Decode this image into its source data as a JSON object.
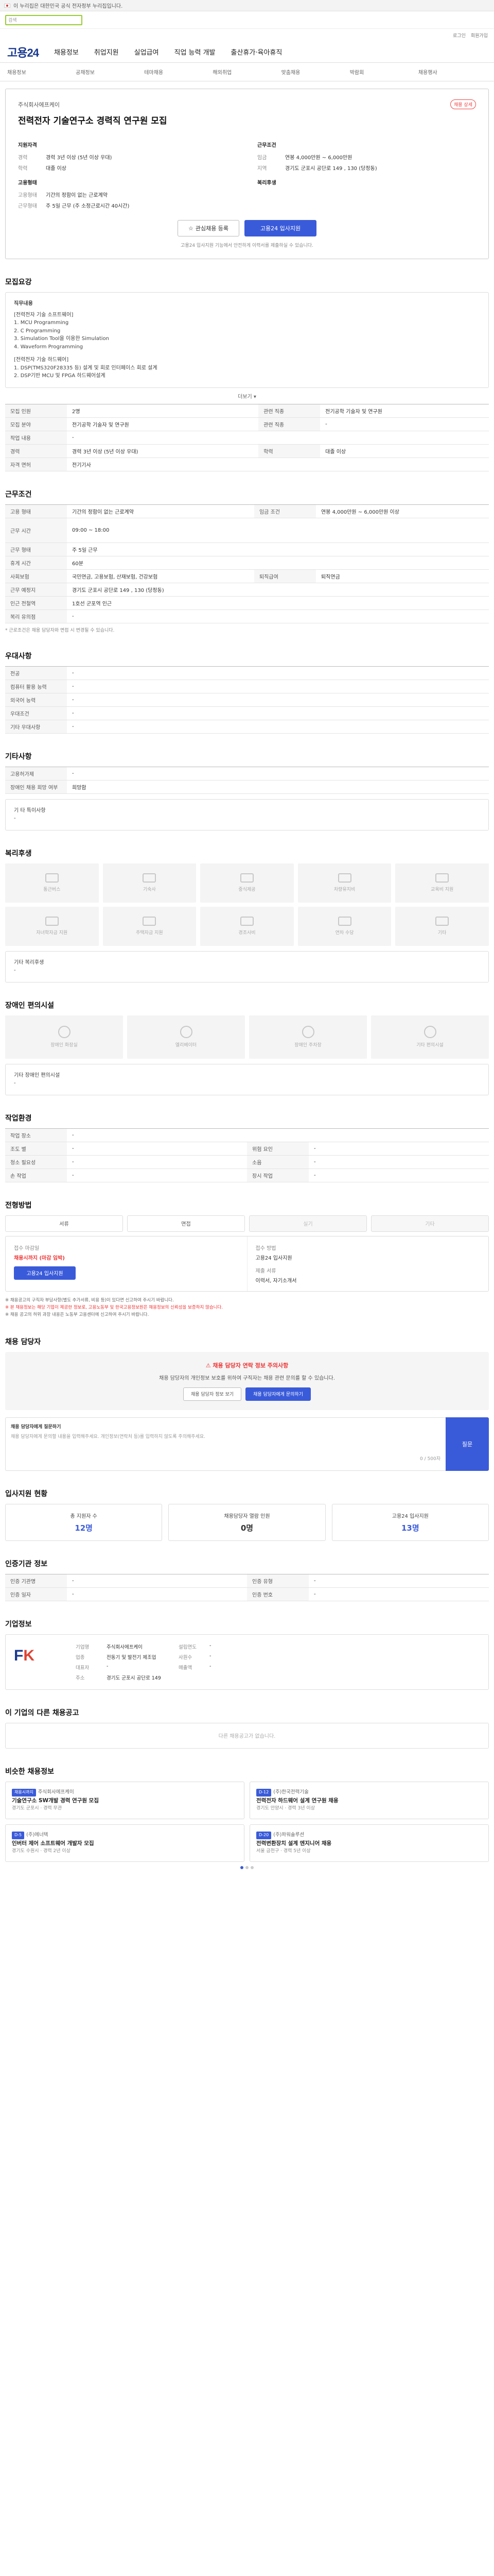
{
  "gov_bar": {
    "text": "이 누리집은 대한민국 공식 전자정부 누리집입니다."
  },
  "search": {
    "placeholder": "검색"
  },
  "top_links": [
    "로그인",
    "회원가입"
  ],
  "gnb": {
    "logo": "고용24",
    "items": [
      "채용정보",
      "취업지원",
      "실업급여",
      "직업 능력 개발",
      "출산휴가·육아휴직"
    ]
  },
  "subnav": [
    "채용정보",
    "공채정보",
    "테마채용",
    "해외취업",
    "맞춤채용",
    "박람회",
    "채용행사"
  ],
  "header": {
    "company": "주식회사에프케이",
    "share": "채용 상세",
    "title": "전력전자 기술연구소 경력직 연구원 모집",
    "left_title": "지원자격",
    "left": [
      {
        "k": "경력",
        "v": "경력 3년 이상 (5년 이상 우대)"
      },
      {
        "k": "학력",
        "v": "대졸 이상"
      }
    ],
    "left2_title": "고용형태",
    "left2": [
      {
        "k": "고용형태",
        "v": "기간의 정함이 없는 근로계약"
      },
      {
        "k": "근무형태",
        "v": "주 5일 근무 (주 소정근로시간 40시간)"
      }
    ],
    "right_title": "근무조건",
    "right": [
      {
        "k": "임금",
        "v": "연봉 4,000만원 ~ 6,000만원"
      },
      {
        "k": "지역",
        "v": "경기도 군포시 공단로 149 , 130 (당정동)"
      }
    ],
    "right2_title": "복리후생",
    "btn_save": "관심채용 등록",
    "btn_apply": "고용24 입사지원",
    "note": "고용24 입사지원 기능에서 안전하게 이력서를 제출하실 수 있습니다."
  },
  "duty": {
    "title": "모집요강",
    "body_title": "직무내용",
    "lines": [
      "[전력전자 기술 소프트웨어]",
      "1. MCU Programming",
      "2. C Programming",
      "3. Simulation Tool을 이용한 Simulation",
      "4. Waveform Programming",
      "",
      "[전력전자 기술 하드웨어]",
      "1. DSP(TMS320F28335 등) 설계 및 회로 인터페이스 회로 설계",
      "2. DSP기반 MCU 및 FPGA 하드웨어설계"
    ],
    "more": "더보기 ▾",
    "table": [
      [
        "모집 인원",
        "2명",
        "관련 직종",
        "전기공학 기술자 및 연구원"
      ],
      [
        "모집 분야",
        "전기공학 기술자 및 연구원",
        "관련 직종",
        "-"
      ],
      [
        "작업 내용",
        "-",
        "",
        ""
      ],
      [
        "경력",
        "경력 3년 이상 (5년 이상 우대)",
        "학력",
        "대졸 이상"
      ],
      [
        "자격 면허",
        "전기기사",
        "",
        ""
      ]
    ]
  },
  "conditions": {
    "title": "근무조건",
    "rows": [
      [
        "고용 형태",
        "기간의 정함이 없는 근로계약",
        "임금 조건",
        "연봉 4,000만원 ~ 6,000만원 이상"
      ],
      [
        "근무 시간",
        "09:00 ~ 18:00",
        "",
        ""
      ],
      [
        "근무 형태",
        "주 5일 근무",
        "",
        ""
      ],
      [
        "휴게 시간",
        "60분",
        "",
        ""
      ],
      [
        "사회보험",
        "국민연금, 고용보험, 산재보험, 건강보험",
        "퇴직급여",
        "퇴직연금"
      ],
      [
        "근무 예정지",
        "경기도 군포시 공단로 149 , 130 (당정동)",
        "",
        ""
      ],
      [
        "인근 전철역",
        "1호선 군포역 인근",
        "",
        ""
      ],
      [
        "복리 유의점",
        "-",
        "",
        ""
      ]
    ],
    "note": "* 근로조건은 채용 담당자와 면접 시 변경될 수 있습니다."
  },
  "prefer": {
    "title": "우대사항",
    "rows": [
      [
        "전공",
        "-"
      ],
      [
        "컴퓨터 활용 능력",
        "-"
      ],
      [
        "외국어 능력",
        "-"
      ],
      [
        "우대조건",
        "-"
      ],
      [
        "기타 우대사항",
        "-"
      ]
    ]
  },
  "etc": {
    "title": "기타사항",
    "rows": [
      [
        "고용허가제",
        "-"
      ],
      [
        "장애인 채용 희망 여부",
        "희망함"
      ]
    ],
    "extra_label": "기 타 특이사항",
    "extra_value": "-"
  },
  "benefits": {
    "title": "복리후생",
    "items": [
      "통근버스",
      "기숙사",
      "중식제공",
      "차량유지비",
      "교육비 지원",
      "자녀학자금 지원",
      "주택자금 지원",
      "경조사비",
      "연차 수당",
      "기타"
    ],
    "extra_label": "기타 복리후생",
    "extra_value": "-"
  },
  "disabled": {
    "title": "장애인 편의시설",
    "items": [
      "장애인 화장실",
      "엘리베이터",
      "장애인 주차장",
      "기타 편의시설"
    ],
    "extra_label": "기타 장애인 편의시설",
    "extra_value": "-"
  },
  "env": {
    "title": "작업환경",
    "rows": [
      [
        "작업 장소",
        "-",
        "",
        ""
      ],
      [
        "조도 별",
        "-",
        "위험 요인",
        "-"
      ],
      [
        "청소 필요성",
        "-",
        "소음",
        "-"
      ],
      [
        "손 작업",
        "-",
        "장시 작업",
        "-"
      ]
    ]
  },
  "process": {
    "title": "전형방법",
    "steps": [
      "서류",
      "면접",
      "실기",
      "기타"
    ],
    "col1_label": "접수 마감일",
    "col1_value": "채용시까지 (마감 임박)",
    "col1_btn": "고용24 입사지원",
    "col2_label": "접수 방법",
    "col2_value": "고용24 입사지원",
    "col3_label": "제출 서류",
    "col3_value": "이력서, 자기소개서"
  },
  "notes": [
    "※ 채용공고의 구직자 부담사항(별도 추가서류, 비용 등)이 있다면 신고하여 주시기 바랍니다.",
    "※ 본 채용정보는 해당 기업이 제공한 정보로, 고용노동부 및 한국고용정보원은 채용정보의 신뢰성을 보증하지 않습니다.",
    "※ 채용 공고의 허위 과장 내용은 노동부 고용센터에 신고하여 주시기 바랍니다."
  ],
  "contact": {
    "title": "채용 담당자",
    "warn_title": "⚠ 채용 담당자 연락 정보 주의사항",
    "warn_body": "채용 담당자의 개인정보 보호를 위하여 구직자는 채용 관련 문의를 할 수 있습니다.",
    "btn1": "채용 담당자 정보 보기",
    "btn2": "채용 담당자에게 문의하기",
    "q_title": "채용 담당자에게 질문하기",
    "q_placeholder": "채용 담당자에게 문의할 내용을 입력해주세요. 개인정보(연락처 등)를 입력하지 않도록 주의해주세요.",
    "q_btn": "질문",
    "q_count": "0 / 500자"
  },
  "stats": {
    "title": "입사지원 현황",
    "items": [
      {
        "label": "총 지원자 수",
        "value": "12명"
      },
      {
        "label": "채용담당자 열람 인원",
        "value": "0명"
      },
      {
        "label": "고용24 입사지원",
        "value": "13명"
      }
    ]
  },
  "info": {
    "title": "인증기관 정보",
    "rows": [
      [
        "인증 기관명",
        "-",
        "인증 유형",
        "-"
      ],
      [
        "인증 일자",
        "-",
        "인증 번호",
        "-"
      ]
    ]
  },
  "company": {
    "title": "기업정보",
    "logo_main": "F",
    "logo_accent": "K",
    "rows": [
      [
        "기업명",
        "주식회사에프케이",
        "설립연도",
        "-"
      ],
      [
        "업종",
        "전동기 및 발전기 제조업",
        "사원수",
        "-"
      ],
      [
        "대표자",
        "-",
        "매출액",
        "-"
      ],
      [
        "주소",
        "경기도 군포시 공단로 149",
        "",
        ""
      ]
    ]
  },
  "other_jobs": {
    "title": "이 기업의 다른 채용공고",
    "empty": "다른 채용공고가 없습니다."
  },
  "similar": {
    "title": "비슷한 채용정보",
    "jobs": [
      {
        "dday": "채용시까지",
        "co": "주식회사에프케이",
        "tit": "기술연구소 SW개발 경력 연구원 모집",
        "meta": "경기도 군포시 · 경력 무관"
      },
      {
        "dday": "D-12",
        "co": "(주)한국전력기술",
        "tit": "전력전자 하드웨어 설계 연구원 채용",
        "meta": "경기도 안양시 · 경력 3년 이상"
      },
      {
        "dday": "D-5",
        "co": "(주)에너텍",
        "tit": "인버터 제어 소프트웨어 개발자 모집",
        "meta": "경기도 수원시 · 경력 2년 이상"
      },
      {
        "dday": "D-20",
        "co": "(주)파워솔루션",
        "tit": "전력변환장치 설계 엔지니어 채용",
        "meta": "서울 금천구 · 경력 5년 이상"
      }
    ]
  }
}
